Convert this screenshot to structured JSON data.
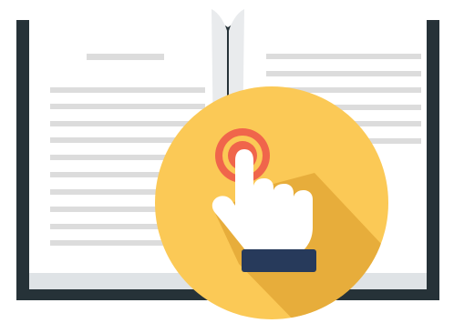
{
  "illustration": {
    "subject": "open-book-with-tap-gesture",
    "icons": [
      "open-book-icon",
      "hand-pointer-icon",
      "tap-ripple-icon"
    ]
  },
  "colors": {
    "book_cover": "#263238",
    "page": "#ffffff",
    "page_shade": "#dfe3e6",
    "text_lines": "#dcdcdc",
    "circle": "#fbc956",
    "circle_shadow": "#e7ad3b",
    "ripple_outer": "#f0654b",
    "ripple_middle": "#fbc956",
    "ripple_inner": "#f0654b",
    "hand": "#ffffff",
    "cuff": "#273a5b"
  }
}
